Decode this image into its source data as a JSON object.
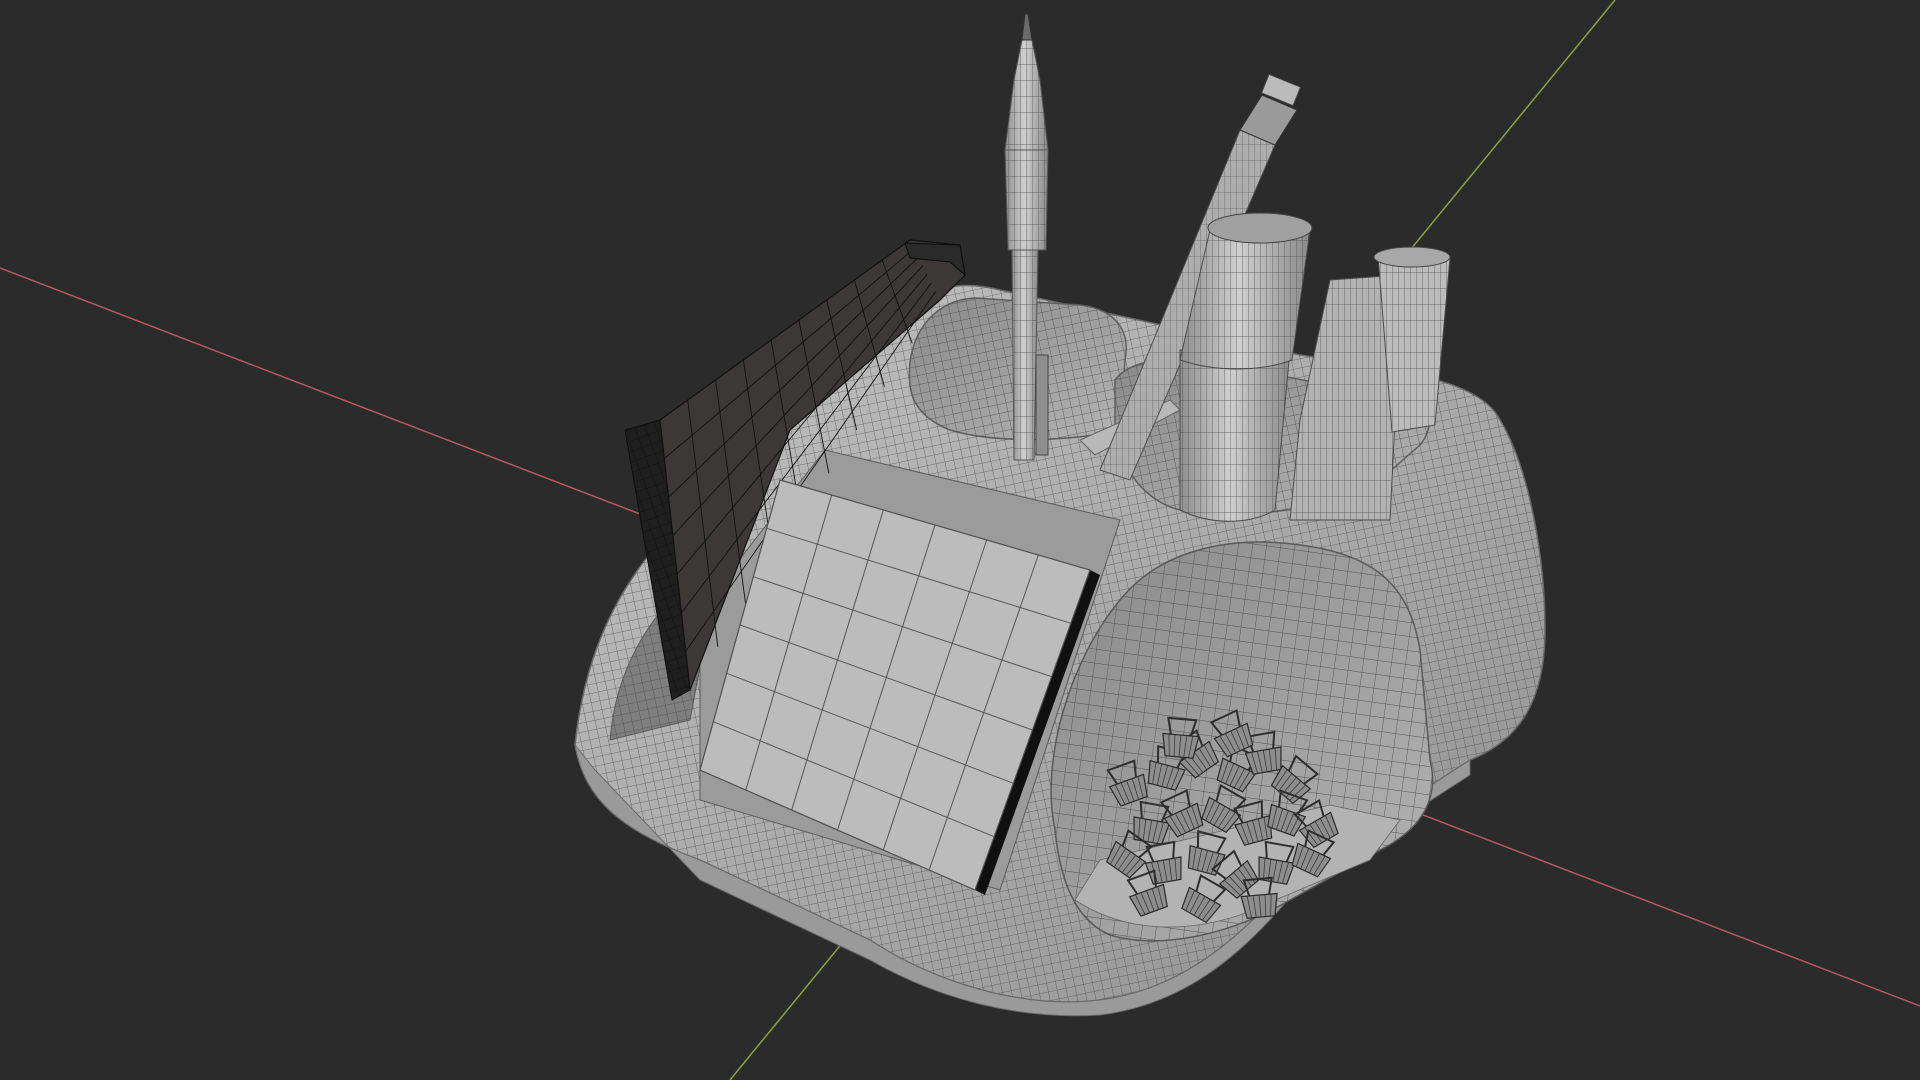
{
  "viewport": {
    "background_color": "#2b2b2b",
    "shading_mode": "solid-wireframe-overlay"
  },
  "axes": {
    "x_axis_color": "#b05a66",
    "y_axis_color": "#8aa33a"
  },
  "scene": {
    "objects": [
      "desk-organizer",
      "mechanical-pencil",
      "wooden-pencil",
      "marker",
      "highlighter",
      "notebook",
      "sticky-note-pad",
      "binder-clips"
    ],
    "colors": {
      "mesh_fill": "#a9a9a9",
      "mesh_light": "#bdbdbd",
      "mesh_shadow": "#8a8a8a",
      "wire": "#4a4a4a",
      "notebook_dark": "#3c3838"
    }
  }
}
